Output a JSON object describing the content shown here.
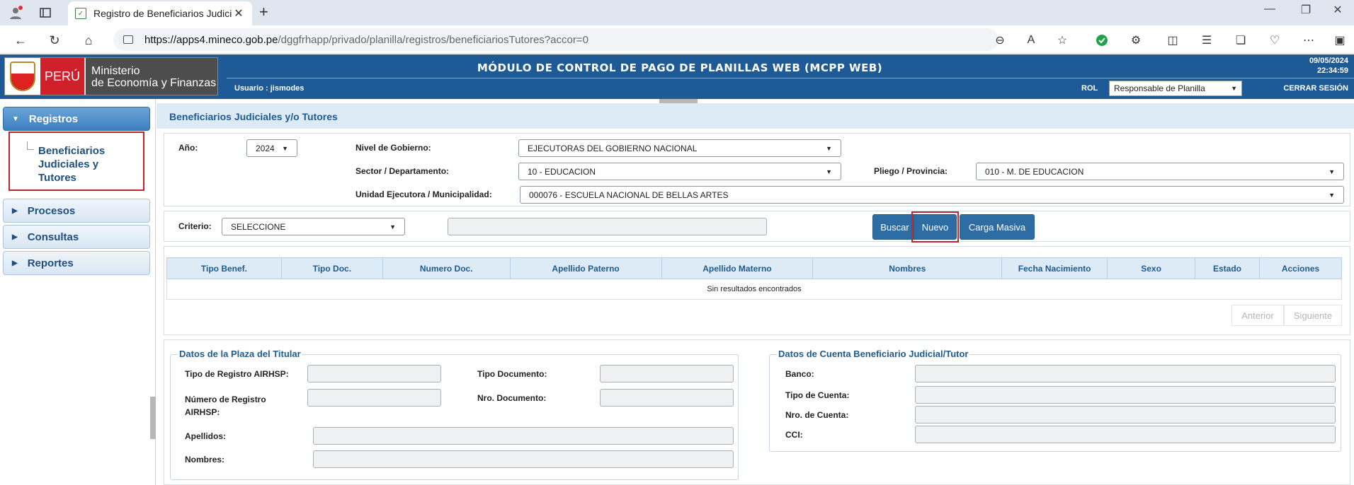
{
  "browser": {
    "tab_title": "Registro de Beneficiarios Judiciale",
    "url_host": "https://apps4.mineco.gob.pe",
    "url_path": "/dggfrhapp/privado/planilla/registros/beneficiariosTutores?accor=0"
  },
  "header": {
    "peru": "PERÚ",
    "ministry_line1": "Ministerio",
    "ministry_line2": "de Economía y Finanzas",
    "title": "MÓDULO DE CONTROL DE PAGO DE PLANILLAS WEB (MCPP WEB)",
    "user": "Usuario : jismodes",
    "rol_label": "ROL",
    "rol_value": "Responsable de Planilla",
    "date": "09/05/2024",
    "time": "22:34:59",
    "logout": "CERRAR SESIÓN"
  },
  "sidebar": {
    "registros": "Registros",
    "sub_item_line1": "Beneficiarios",
    "sub_item_line2": "Judiciales y",
    "sub_item_line3": "Tutores",
    "procesos": "Procesos",
    "consultas": "Consultas",
    "reportes": "Reportes"
  },
  "content": {
    "title": "Beneficiarios Judiciales y/o Tutores",
    "filters": {
      "anio_label": "Año:",
      "anio_value": "2024",
      "nivel_label": "Nivel de Gobierno:",
      "nivel_value": "EJECUTORAS DEL GOBIERNO NACIONAL",
      "sector_label": "Sector / Departamento:",
      "sector_value": "10 - EDUCACION",
      "pliego_label": "Pliego / Provincia:",
      "pliego_value": "010 - M. DE EDUCACION",
      "unidad_label": "Unidad Ejecutora / Municipalidad:",
      "unidad_value": "000076 - ESCUELA NACIONAL DE BELLAS ARTES"
    },
    "search": {
      "criterio_label": "Criterio:",
      "criterio_value": "SELECCIONE",
      "buscar": "Buscar",
      "nuevo": "Nuevo",
      "carga_masiva": "Carga Masiva"
    },
    "table": {
      "columns": [
        "Tipo Benef.",
        "Tipo Doc.",
        "Numero Doc.",
        "Apellido Paterno",
        "Apellido Materno",
        "Nombres",
        "Fecha Nacimiento",
        "Sexo",
        "Estado",
        "Acciones"
      ],
      "empty": "Sin resultados encontrados"
    },
    "pager": {
      "prev": "Anterior",
      "next": "Siguiente"
    },
    "plaza": {
      "legend": "Datos de la Plaza del Titular",
      "tipo_registro": "Tipo de Registro AIRHSP:",
      "numero_registro_1": "Número de Registro",
      "numero_registro_2": "AIRHSP:",
      "tipo_documento": "Tipo Documento:",
      "nro_documento": "Nro. Documento:",
      "apellidos": "Apellidos:",
      "nombres": "Nombres:"
    },
    "cuenta": {
      "legend": "Datos de Cuenta Beneficiario Judicial/Tutor",
      "banco": "Banco:",
      "tipo_cuenta": "Tipo de Cuenta:",
      "nro_cuenta": "Nro. de Cuenta:",
      "cci": "CCI:"
    }
  }
}
